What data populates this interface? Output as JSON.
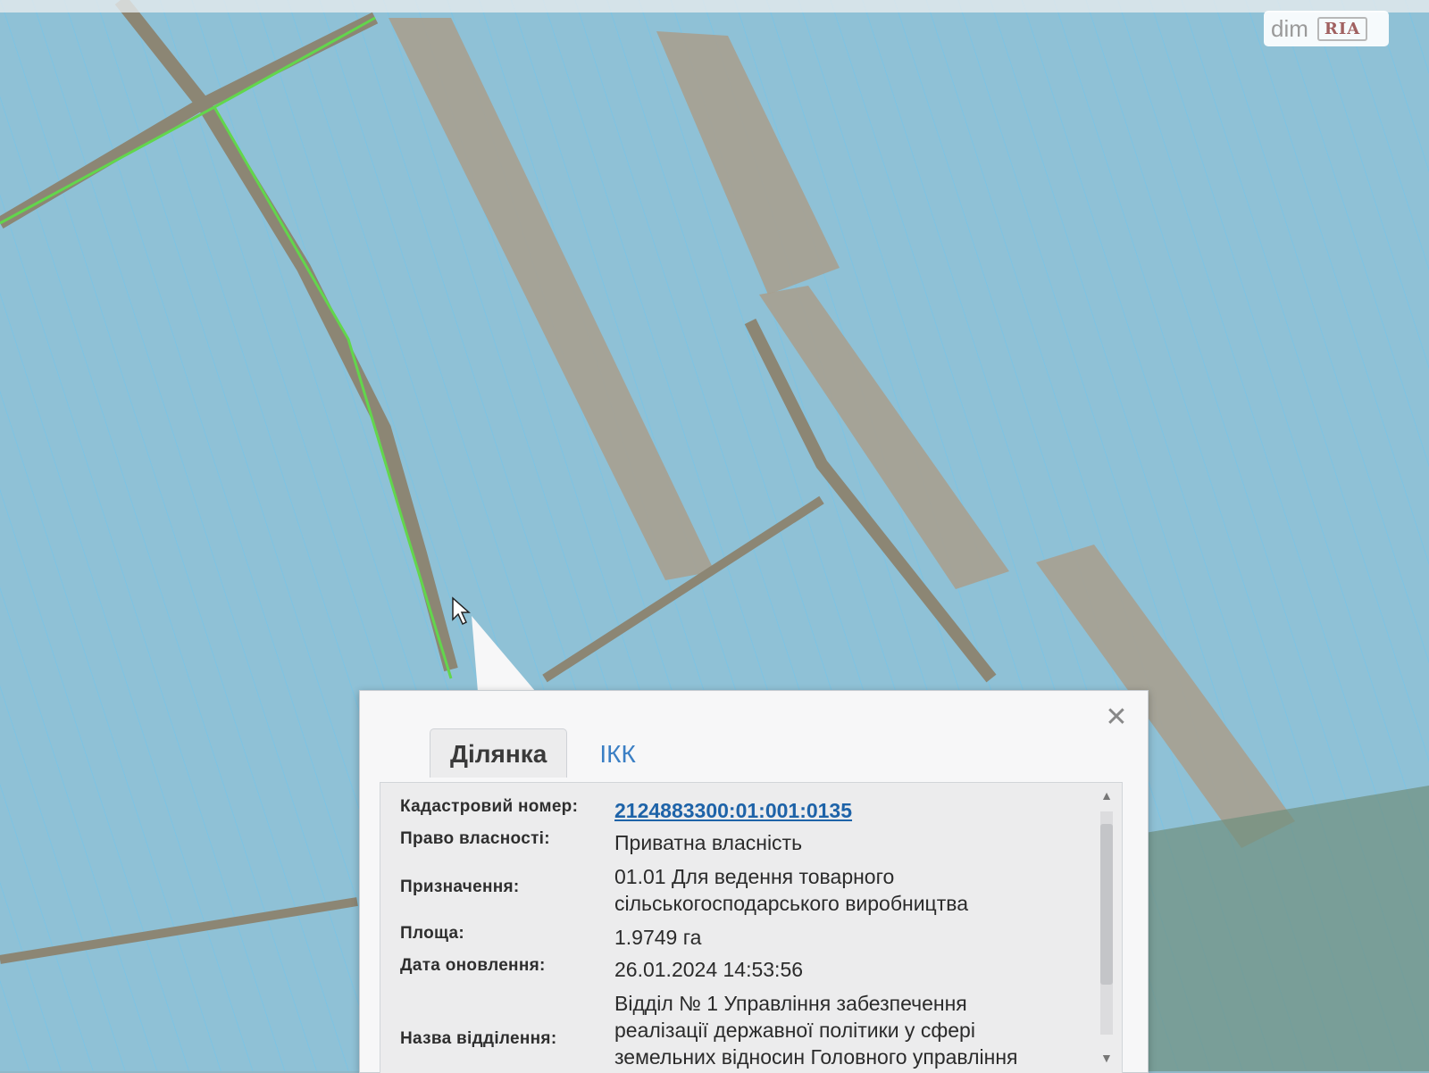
{
  "watermark": {
    "text": "dim",
    "logo": "RIA"
  },
  "map": {
    "parcel_fill": "#8fc1d6",
    "boundary_line": "#6ec6ee",
    "road_color": "#9e9684",
    "highlight_line": "#62d64c",
    "pointer_icon": "cursor-arrow-icon"
  },
  "popup": {
    "close_label": "✕",
    "tabs": [
      {
        "label": "Ділянка",
        "active": true
      },
      {
        "label": "ІКК",
        "active": false
      }
    ],
    "fields": [
      {
        "label": "Кадастровий номер:",
        "value": "2124883300:01:001:0135"
      },
      {
        "label": "Право власності:",
        "value": "Приватна власність"
      },
      {
        "label": "Призначення:",
        "value": "01.01 Для ведення товарного сільськогосподарського виробництва"
      },
      {
        "label": "Площа:",
        "value": "1.9749 га"
      },
      {
        "label": "Дата оновлення:",
        "value": "26.01.2024 14:53:56"
      },
      {
        "label": "Назва відділення:",
        "value": "Відділ № 1 Управління забезпечення реалізації державної політики у сфері земельних відносин Головного управління"
      }
    ]
  }
}
